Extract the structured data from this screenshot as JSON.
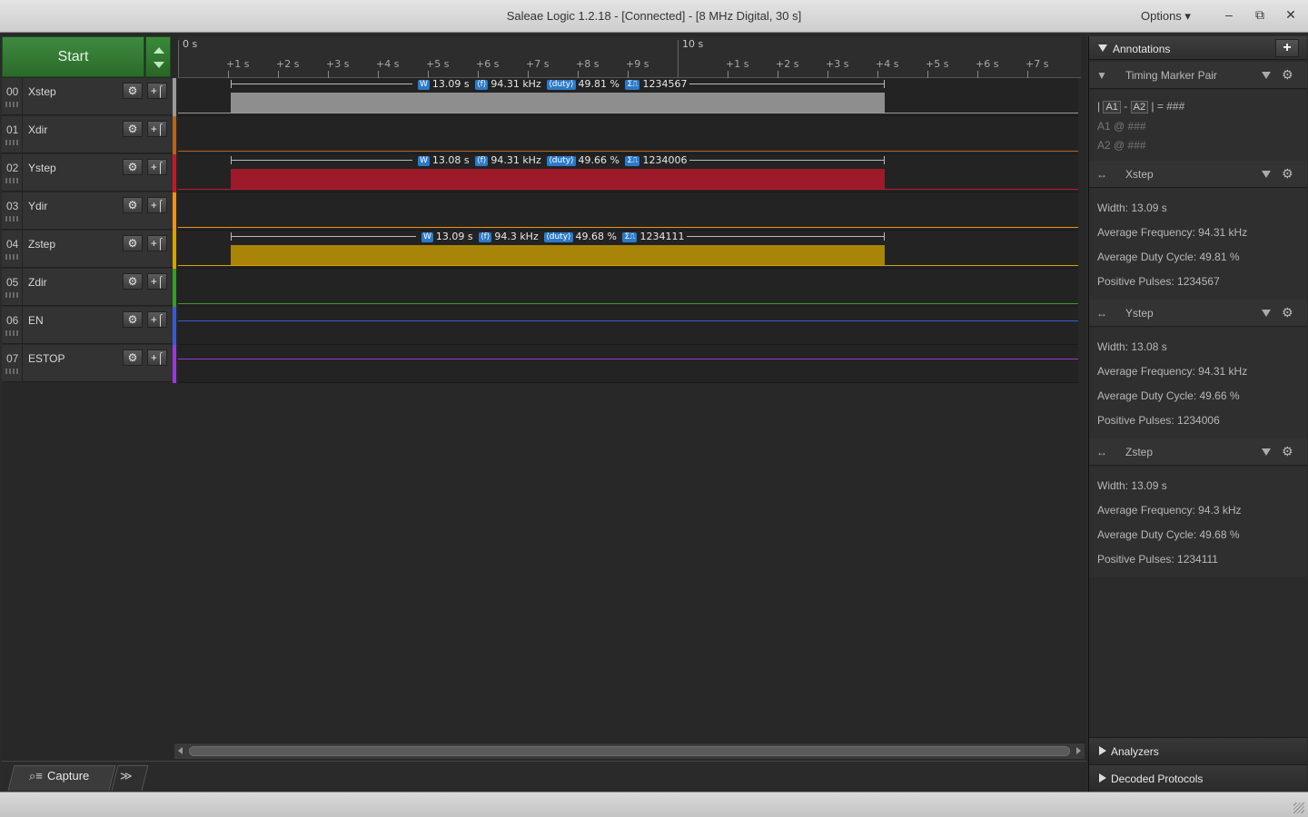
{
  "window": {
    "title": "Saleae Logic 1.2.18 - [Connected] - [8 MHz Digital, 30 s]",
    "options_label": "Options ▾",
    "minimize": "–",
    "restore": "⧉",
    "close": "✕"
  },
  "start": {
    "label": "Start"
  },
  "ruler": {
    "major": [
      "0 s",
      "10 s"
    ],
    "minor": [
      "+1 s",
      "+2 s",
      "+3 s",
      "+4 s",
      "+5 s",
      "+6 s",
      "+7 s",
      "+8 s",
      "+9 s",
      "+1 s",
      "+2 s",
      "+3 s",
      "+4 s",
      "+5 s",
      "+6 s",
      "+7 s"
    ]
  },
  "channels": [
    {
      "num": "00",
      "name": "Xstep",
      "color": "#9a9a9a"
    },
    {
      "num": "01",
      "name": "Xdir",
      "color": "#b5651d"
    },
    {
      "num": "02",
      "name": "Ystep",
      "color": "#c0192c"
    },
    {
      "num": "03",
      "name": "Ydir",
      "color": "#e8941a"
    },
    {
      "num": "04",
      "name": "Zstep",
      "color": "#d4a300"
    },
    {
      "num": "05",
      "name": "Zdir",
      "color": "#3a9a2a"
    },
    {
      "num": "06",
      "name": "EN",
      "color": "#3a5ad4"
    },
    {
      "num": "07",
      "name": "ESTOP",
      "color": "#9a3ad4"
    }
  ],
  "measurements": [
    {
      "width": "13.09 s",
      "freq": "94.31 kHz",
      "duty": "49.81 %",
      "pulses": "1234567"
    },
    {
      "width": "13.08 s",
      "freq": "94.31 kHz",
      "duty": "49.66 %",
      "pulses": "1234006"
    },
    {
      "width": "13.09 s",
      "freq": "94.3 kHz",
      "duty": "49.68 %",
      "pulses": "1234111"
    }
  ],
  "tags": {
    "w": "W",
    "f": "⟨f⟩",
    "duty": "⟨duty⟩",
    "sum": "Σ⎍"
  },
  "channel_buttons": {
    "gear": "⚙",
    "trigger": "+⌠"
  },
  "bottom": {
    "capture_label": "Capture",
    "capture_icon": "⌕≡",
    "more_icon": "≫"
  },
  "annotations": {
    "title": "Annotations",
    "add": "+",
    "timing_pair": {
      "name": "Timing Marker Pair",
      "a1": "A1",
      "a2": "A2",
      "formula_sep": "-",
      "formula_eq": "| = ###",
      "a1_line": "A1  @  ###",
      "a2_line": "A2  @  ###"
    },
    "groups": [
      {
        "name": "Xstep",
        "width": "Width: 13.09 s",
        "freq": "Average Frequency: 94.31 kHz",
        "duty": "Average Duty Cycle: 49.81 %",
        "pulses": "Positive Pulses: 1234567"
      },
      {
        "name": "Ystep",
        "width": "Width: 13.08 s",
        "freq": "Average Frequency: 94.31 kHz",
        "duty": "Average Duty Cycle: 49.66 %",
        "pulses": "Positive Pulses: 1234006"
      },
      {
        "name": "Zstep",
        "width": "Width: 13.09 s",
        "freq": "Average Frequency: 94.3 kHz",
        "duty": "Average Duty Cycle: 49.68 %",
        "pulses": "Positive Pulses: 1234111"
      }
    ],
    "group_icon": "↔",
    "pin_icon": "📍",
    "gear_icon": "⚙"
  },
  "sections": {
    "analyzers": "Analyzers",
    "decoded": "Decoded Protocols"
  }
}
